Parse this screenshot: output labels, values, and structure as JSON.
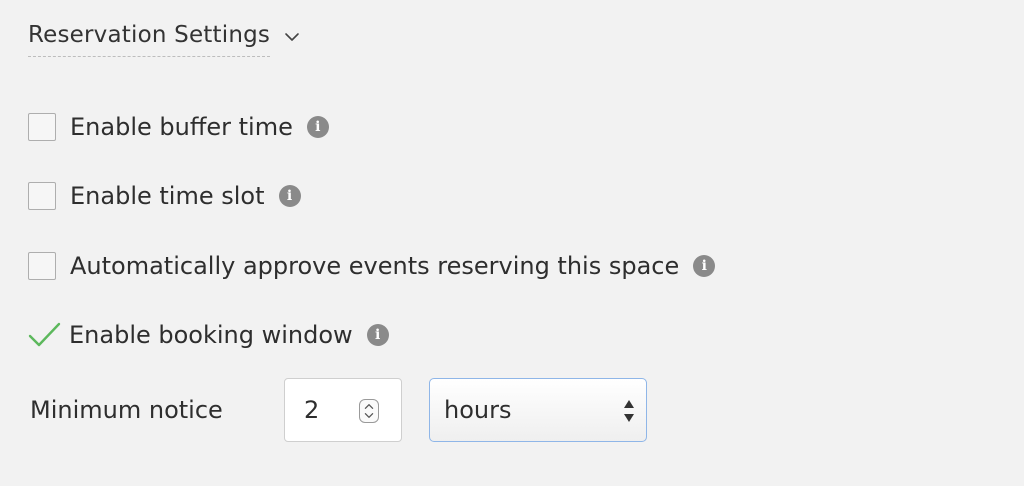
{
  "section": {
    "title": "Reservation Settings"
  },
  "options": [
    {
      "label": "Enable buffer time",
      "checked": false
    },
    {
      "label": "Enable time slot",
      "checked": false
    },
    {
      "label": "Automatically approve events reserving this space",
      "checked": false
    },
    {
      "label": "Enable booking window",
      "checked": true
    }
  ],
  "info_icon_glyph": "i",
  "minimum_notice": {
    "label": "Minimum notice",
    "value": "2",
    "unit": "hours"
  },
  "colors": {
    "checkmark": "#5cb85c",
    "info_icon": "#8a8a8a",
    "select_border": "#8fb6e8"
  }
}
